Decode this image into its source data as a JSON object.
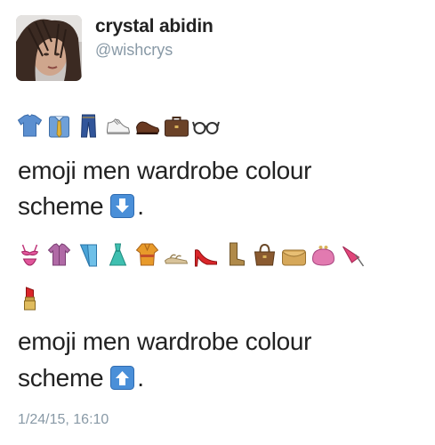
{
  "user": {
    "display_name": "crystal abidin",
    "handle": "@wishcrys"
  },
  "tweet": {
    "line1": "emoji men wardrobe colour",
    "scheme_word": "scheme",
    "period": ".",
    "timestamp": "1/24/15, 16:10"
  },
  "emojis": {
    "men_row": [
      "tshirt-icon",
      "dress-shirt-tie-icon",
      "jeans-icon",
      "sneaker-icon",
      "dress-shoe-icon",
      "briefcase-icon",
      "eyeglasses-icon"
    ],
    "women_row": [
      "bikini-icon",
      "blouse-icon",
      "kimono-icon",
      "dress-icon",
      "robe-icon",
      "sandal-icon",
      "high-heel-icon",
      "boot-icon",
      "handbag-icon",
      "clutch-icon",
      "purse-icon",
      "umbrella-icon"
    ],
    "women_row_2": [
      "lipstick-icon"
    ],
    "down_arrow": "down-arrow-key-icon",
    "up_arrow": "up-arrow-key-icon"
  },
  "colors": {
    "text": "#222222",
    "secondary": "#8899a6",
    "arrow_key": "#4a8fd8"
  }
}
